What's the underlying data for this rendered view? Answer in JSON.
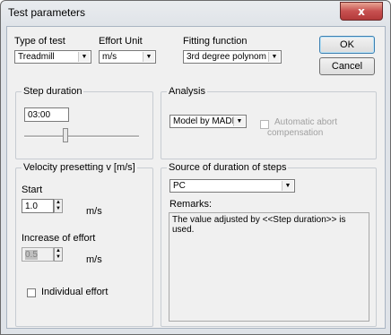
{
  "window": {
    "title": "Test parameters",
    "close_glyph": "x"
  },
  "top": {
    "type_of_test": {
      "label": "Type of test",
      "value": "Treadmill"
    },
    "effort_unit": {
      "label": "Effort Unit",
      "value": "m/s"
    },
    "fitting_function": {
      "label": "Fitting function",
      "value": "3rd degree polynom"
    }
  },
  "buttons": {
    "ok": "OK",
    "cancel": "Cancel"
  },
  "step_duration": {
    "legend": "Step duration",
    "value": "03:00",
    "slider_fraction": 0.35
  },
  "analysis": {
    "legend": "Analysis",
    "model": "Model by MADER",
    "auto_abort_line1": "Automatic abort",
    "auto_abort_line2": "compensation"
  },
  "velocity": {
    "legend": "Velocity presetting v [m/s]",
    "start_label": "Start",
    "start_value": "1.0",
    "start_unit": "m/s",
    "increase_label": "Increase of effort",
    "increase_value": "0.5",
    "increase_unit": "m/s",
    "individual_effort_label": "Individual effort"
  },
  "source": {
    "legend": "Source of duration of steps",
    "value": "PC",
    "remarks_label": "Remarks:",
    "remarks_text": "The value adjusted by <<Step duration>> is used."
  }
}
